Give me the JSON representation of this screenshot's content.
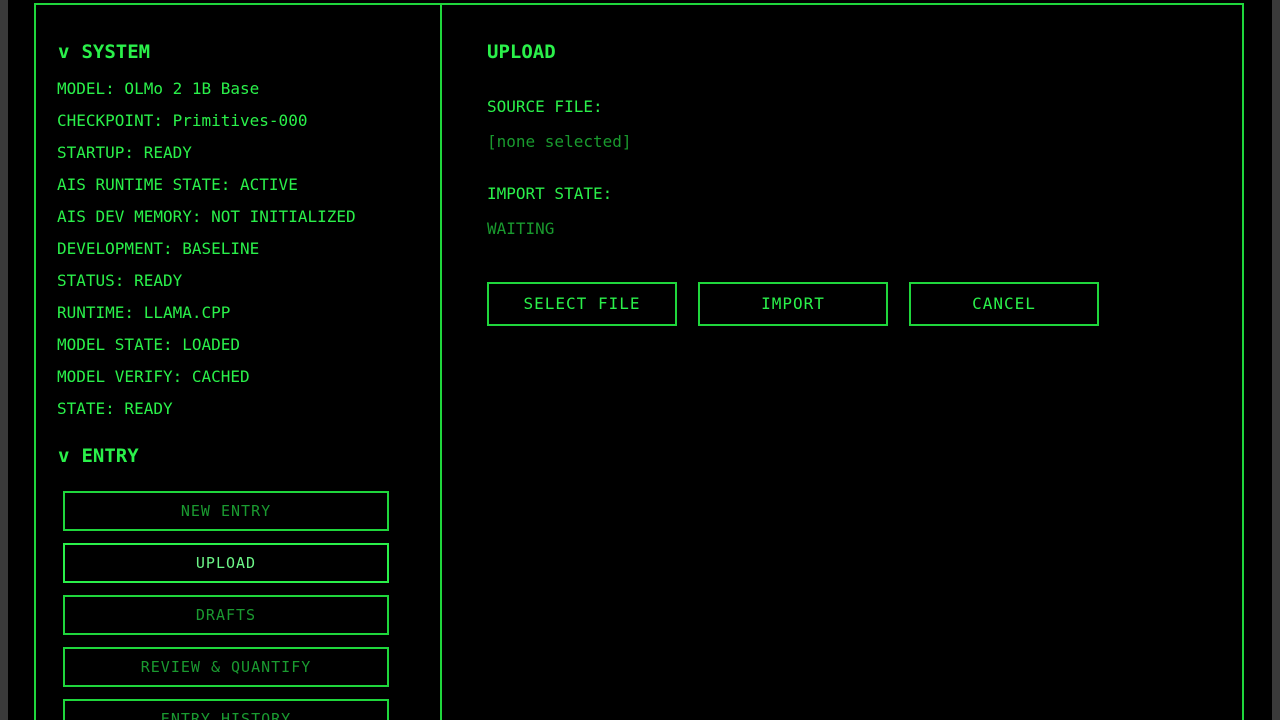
{
  "system": {
    "chevron": "v",
    "title": "SYSTEM",
    "lines": [
      "MODEL: OLMo 2 1B Base",
      "CHECKPOINT: Primitives-000",
      "STARTUP: READY",
      "AIS RUNTIME STATE: ACTIVE",
      "AIS DEV MEMORY: NOT INITIALIZED",
      "DEVELOPMENT: BASELINE",
      "STATUS: READY",
      "RUNTIME: LLAMA.CPP",
      "MODEL STATE: LOADED",
      "MODEL VERIFY: CACHED",
      "STATE: READY"
    ]
  },
  "entry": {
    "chevron": "v",
    "title": "ENTRY",
    "items": [
      {
        "label": "NEW ENTRY"
      },
      {
        "label": "UPLOAD"
      },
      {
        "label": "DRAFTS"
      },
      {
        "label": "REVIEW & QUANTIFY"
      },
      {
        "label": "ENTRY HISTORY"
      }
    ]
  },
  "upload": {
    "title": "UPLOAD",
    "source_label": "SOURCE FILE:",
    "source_value": "[none selected]",
    "import_label": "IMPORT STATE:",
    "import_value": "WAITING",
    "buttons": {
      "select": "SELECT FILE",
      "import": "IMPORT",
      "cancel": "CANCEL"
    }
  },
  "colors": {
    "accent": "#2af04a",
    "dim": "#199a2e",
    "background": "#000000"
  }
}
